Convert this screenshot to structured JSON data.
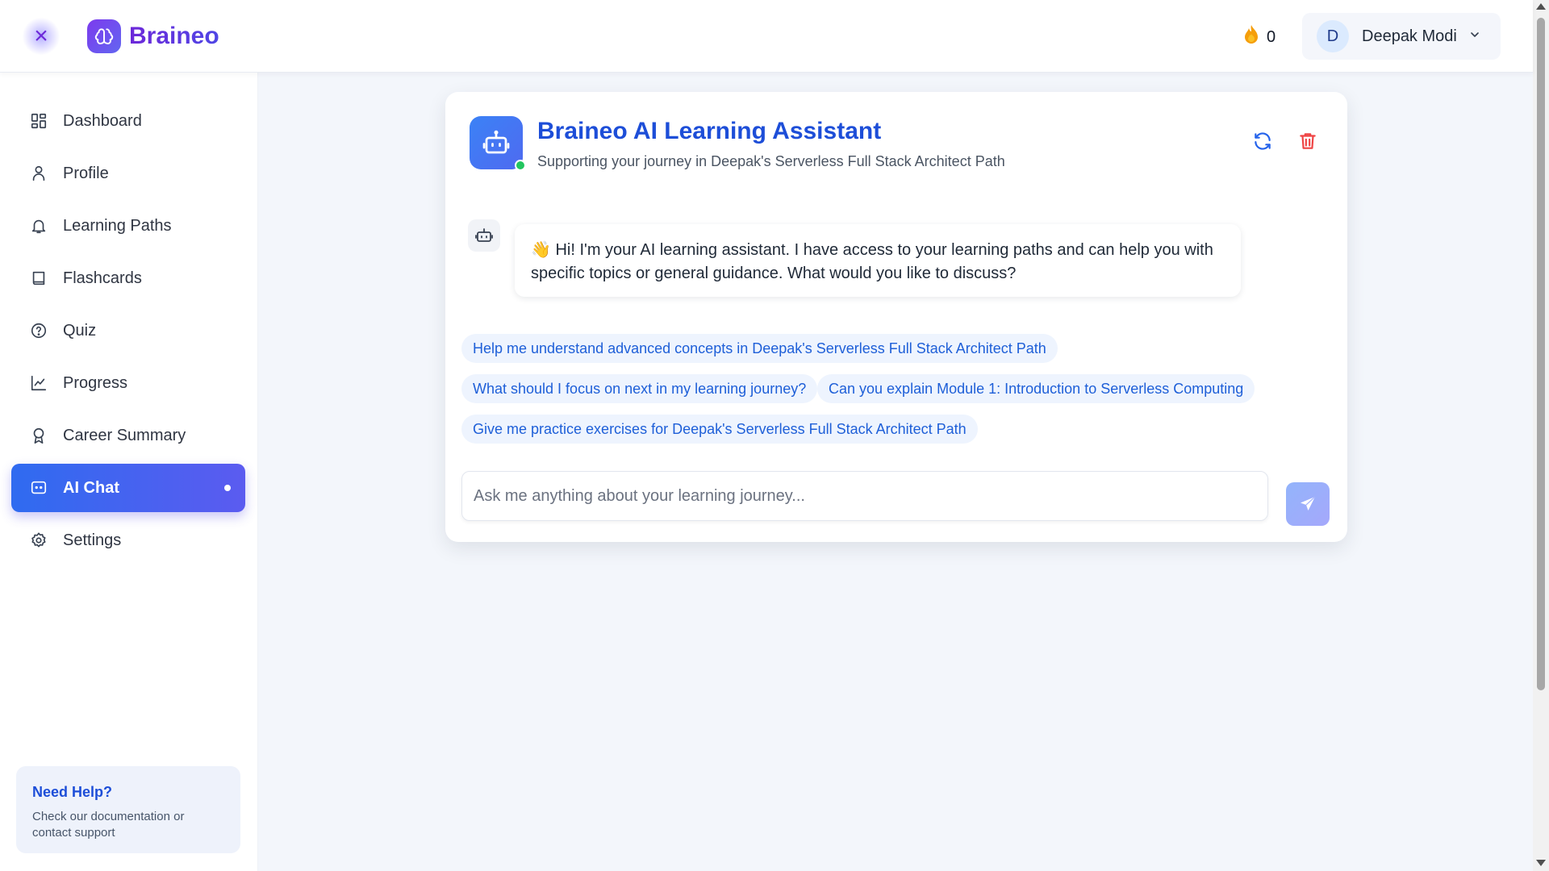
{
  "header": {
    "close_icon": "×",
    "brand_name": "Braineo",
    "streak_count": "0",
    "user": {
      "initial": "D",
      "name": "Deepak Modi"
    }
  },
  "sidebar": {
    "items": [
      {
        "label": "Dashboard",
        "icon": "dashboard-icon"
      },
      {
        "label": "Profile",
        "icon": "user-icon"
      },
      {
        "label": "Learning Paths",
        "icon": "bell-icon"
      },
      {
        "label": "Flashcards",
        "icon": "book-icon"
      },
      {
        "label": "Quiz",
        "icon": "help-circle-icon"
      },
      {
        "label": "Progress",
        "icon": "line-chart-icon"
      },
      {
        "label": "Career Summary",
        "icon": "award-icon"
      },
      {
        "label": "AI Chat",
        "icon": "chat-icon",
        "active": true
      },
      {
        "label": "Settings",
        "icon": "gear-icon"
      }
    ],
    "help": {
      "title": "Need Help?",
      "text": "Check our documentation or contact support"
    }
  },
  "chat": {
    "title": "Braineo AI Learning Assistant",
    "subtitle": "Supporting your journey in Deepak's Serverless Full Stack Architect Path",
    "message": "👋 Hi! I'm your AI learning assistant. I have access to your learning paths and can help you with specific topics or general guidance. What would you like to discuss?",
    "suggestions": [
      "Help me understand advanced concepts in Deepak's Serverless Full Stack Architect Path",
      "What should I focus on next in my learning journey?",
      "Can you explain Module 1: Introduction to Serverless Computing",
      "Give me practice exercises for Deepak's Serverless Full Stack Architect Path"
    ],
    "input_placeholder": "Ask me anything about your learning journey...",
    "input_value": ""
  },
  "colors": {
    "accent": "#2f6bf0",
    "brand": "#6d28d9",
    "title": "#1d4ed8",
    "danger": "#ef4444",
    "online": "#22c55e"
  }
}
